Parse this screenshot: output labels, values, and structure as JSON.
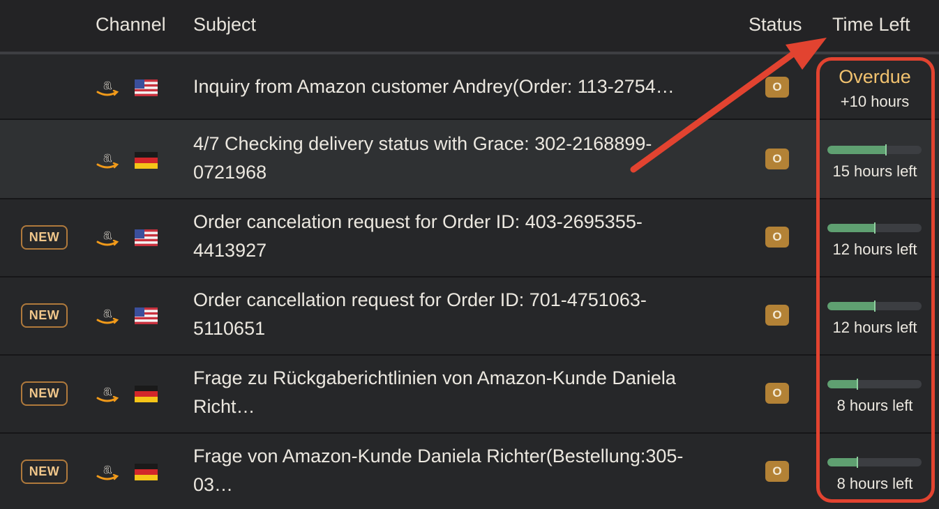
{
  "header": {
    "channel": "Channel",
    "subject": "Subject",
    "status": "Status",
    "time_left": "Time Left"
  },
  "rows": [
    {
      "new_badge": "",
      "channel_icon": "amazon-icon",
      "flag": "us-flag",
      "subject": "Inquiry from Amazon customer Andrey(Order: 113-2754…",
      "status": "O",
      "overdue": "Overdue",
      "time_left": "+10 hours",
      "progress": null
    },
    {
      "new_badge": "",
      "channel_icon": "amazon-icon",
      "flag": "de-flag",
      "subject": "4/7 Checking delivery status with Grace: 302-2168899-0721968",
      "status": "O",
      "time_left": "15 hours left",
      "progress": 0.62
    },
    {
      "new_badge": "NEW",
      "channel_icon": "amazon-icon",
      "flag": "us-flag",
      "subject": "Order cancelation request for Order ID: 403-2695355-4413927",
      "status": "O",
      "time_left": "12 hours left",
      "progress": 0.5
    },
    {
      "new_badge": "NEW",
      "channel_icon": "amazon-icon",
      "flag": "us-flag",
      "subject": "Order cancellation request for Order ID: 701-4751063-5110651",
      "status": "O",
      "time_left": "12 hours left",
      "progress": 0.5
    },
    {
      "new_badge": "NEW",
      "channel_icon": "amazon-icon",
      "flag": "de-flag",
      "subject": "Frage zu Rückgaberichtlinien von Amazon-Kunde Daniela Richt…",
      "status": "O",
      "time_left": "8 hours left",
      "progress": 0.32
    },
    {
      "new_badge": "NEW",
      "channel_icon": "amazon-icon",
      "flag": "de-flag",
      "subject": "Frage von Amazon-Kunde Daniela Richter(Bestellung:305-03…",
      "status": "O",
      "time_left": "8 hours left",
      "progress": 0.32
    }
  ],
  "colors": {
    "background": "#262729",
    "highlight_row": "#2f3133",
    "new_badge": "#b07a3c",
    "status_badge": "#b38236",
    "progress": "#5fa071",
    "overdue": "#f1c26f",
    "annotation": "#e24330"
  }
}
